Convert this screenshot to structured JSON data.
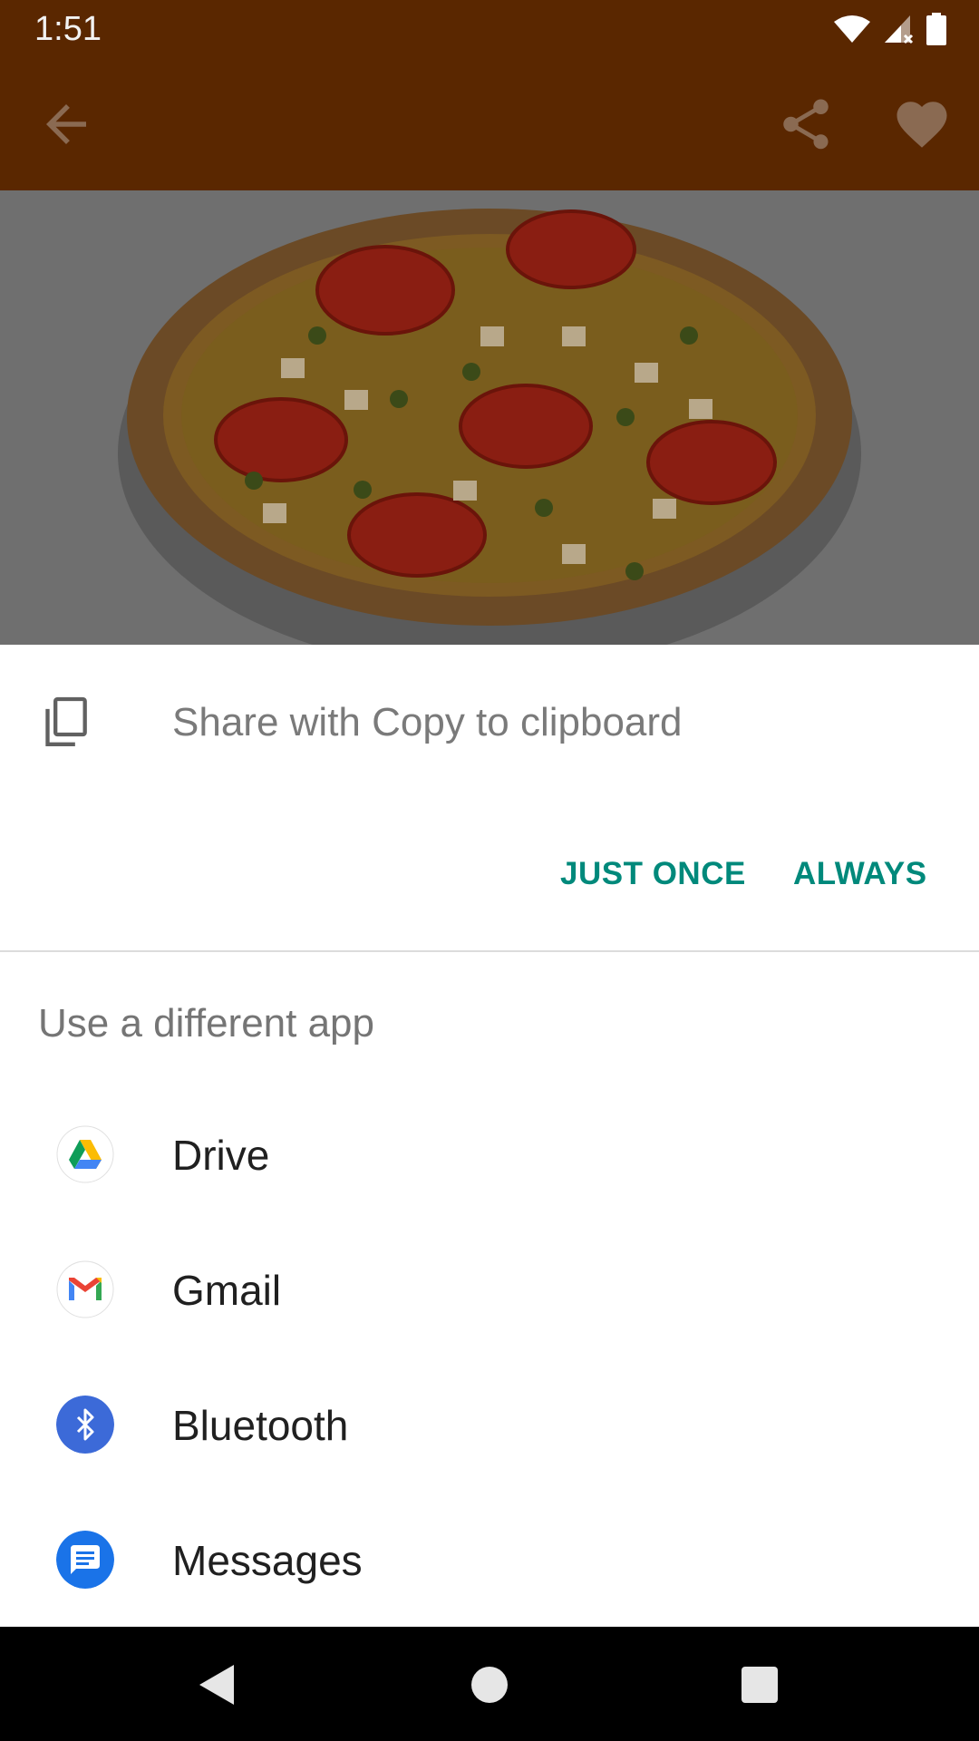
{
  "status_bar": {
    "time": "1:51",
    "icons": [
      "wifi-icon",
      "signal-icon",
      "battery-icon"
    ]
  },
  "app_bar": {
    "icons": [
      "back-arrow-icon",
      "share-icon",
      "heart-icon"
    ],
    "color": "#5a2700"
  },
  "hero": {
    "image": "pizza-image"
  },
  "share_sheet": {
    "title": "Share with Copy to clipboard",
    "just_once": "JUST ONCE",
    "always": "ALWAYS",
    "section_label": "Use a different app",
    "apps": [
      {
        "label": "Drive",
        "icon": "drive-icon"
      },
      {
        "label": "Gmail",
        "icon": "gmail-icon"
      },
      {
        "label": "Bluetooth",
        "icon": "bluetooth-icon"
      },
      {
        "label": "Messages",
        "icon": "messages-icon"
      }
    ],
    "accent_color": "#00897b"
  },
  "nav_bar": {
    "icons": [
      "nav-back-icon",
      "nav-home-icon",
      "nav-recents-icon"
    ]
  }
}
